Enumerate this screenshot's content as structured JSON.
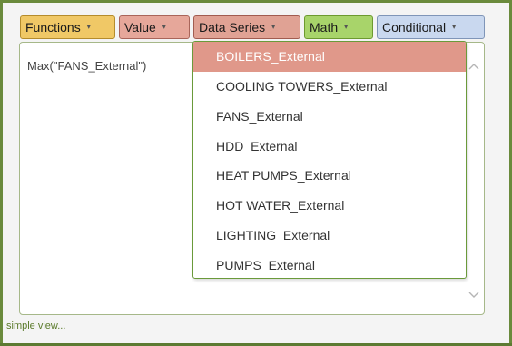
{
  "toolbar": {
    "functions": "Functions",
    "value": "Value",
    "data_series": "Data Series",
    "math": "Math",
    "conditional": "Conditional",
    "caret": "▾"
  },
  "editor": {
    "expression": "Max(\"FANS_External\")"
  },
  "dropdown": {
    "items": [
      "BOILERS_External",
      "COOLING TOWERS_External",
      "FANS_External",
      "HDD_External",
      "HEAT PUMPS_External",
      "HOT WATER_External",
      "LIGHTING_External",
      "PUMPS_External"
    ],
    "highlighted_index": 0
  },
  "footer": {
    "simple_view": "simple view..."
  },
  "colors": {
    "functions": "#f0c866",
    "value": "#e6a79a",
    "data_series": "#e0a294",
    "math": "#a8d46a",
    "conditional": "#c9d8ef",
    "highlight": "#e0988a",
    "frame_border": "#6a8a3c"
  },
  "icons": {
    "scroll_up": "chevron-up-icon",
    "scroll_down": "chevron-down-icon",
    "caret": "caret-down-icon"
  }
}
